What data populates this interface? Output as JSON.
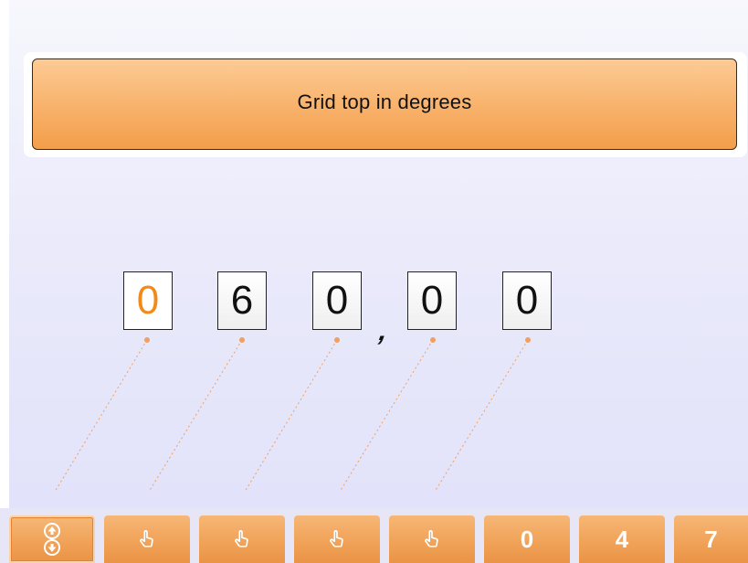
{
  "title": "Grid top in degrees",
  "digits": [
    {
      "value": "0",
      "active": true
    },
    {
      "value": "6",
      "active": false
    },
    {
      "value": "0",
      "active": false
    },
    {
      "value": "0",
      "active": false
    },
    {
      "value": "0",
      "active": false
    }
  ],
  "decimal_separator": ",",
  "toolbar": {
    "buttons": [
      {
        "kind": "icon",
        "icon": "up-down-arrows-icon"
      },
      {
        "kind": "icon",
        "icon": "hand-pointer-icon"
      },
      {
        "kind": "icon",
        "icon": "hand-pointer-icon"
      },
      {
        "kind": "icon",
        "icon": "hand-pointer-icon"
      },
      {
        "kind": "icon",
        "icon": "hand-pointer-icon"
      },
      {
        "kind": "key",
        "label": "0"
      },
      {
        "kind": "key",
        "label": "4"
      },
      {
        "kind": "key",
        "label": "7"
      }
    ]
  },
  "colors": {
    "accent": "#f39e4a",
    "active_digit": "#f28a1a",
    "background": "#ebebfb",
    "guide_line": "#f0a060"
  }
}
